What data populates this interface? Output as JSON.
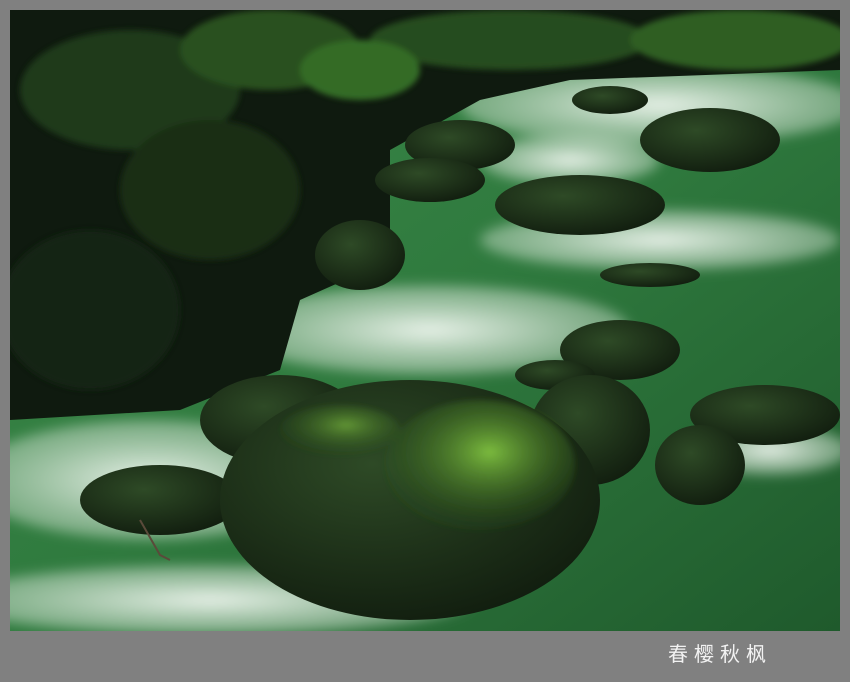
{
  "caption": {
    "signature": "春樱秋枫"
  },
  "photo": {
    "colors": {
      "frame": "#808080",
      "forest_dark": "#0f1a0f",
      "foliage": "#2e5a22",
      "water": "#2f7a3e",
      "foam": "#e6f0e6",
      "moss": "#6fae3a",
      "rock": "#1b2a18"
    }
  }
}
